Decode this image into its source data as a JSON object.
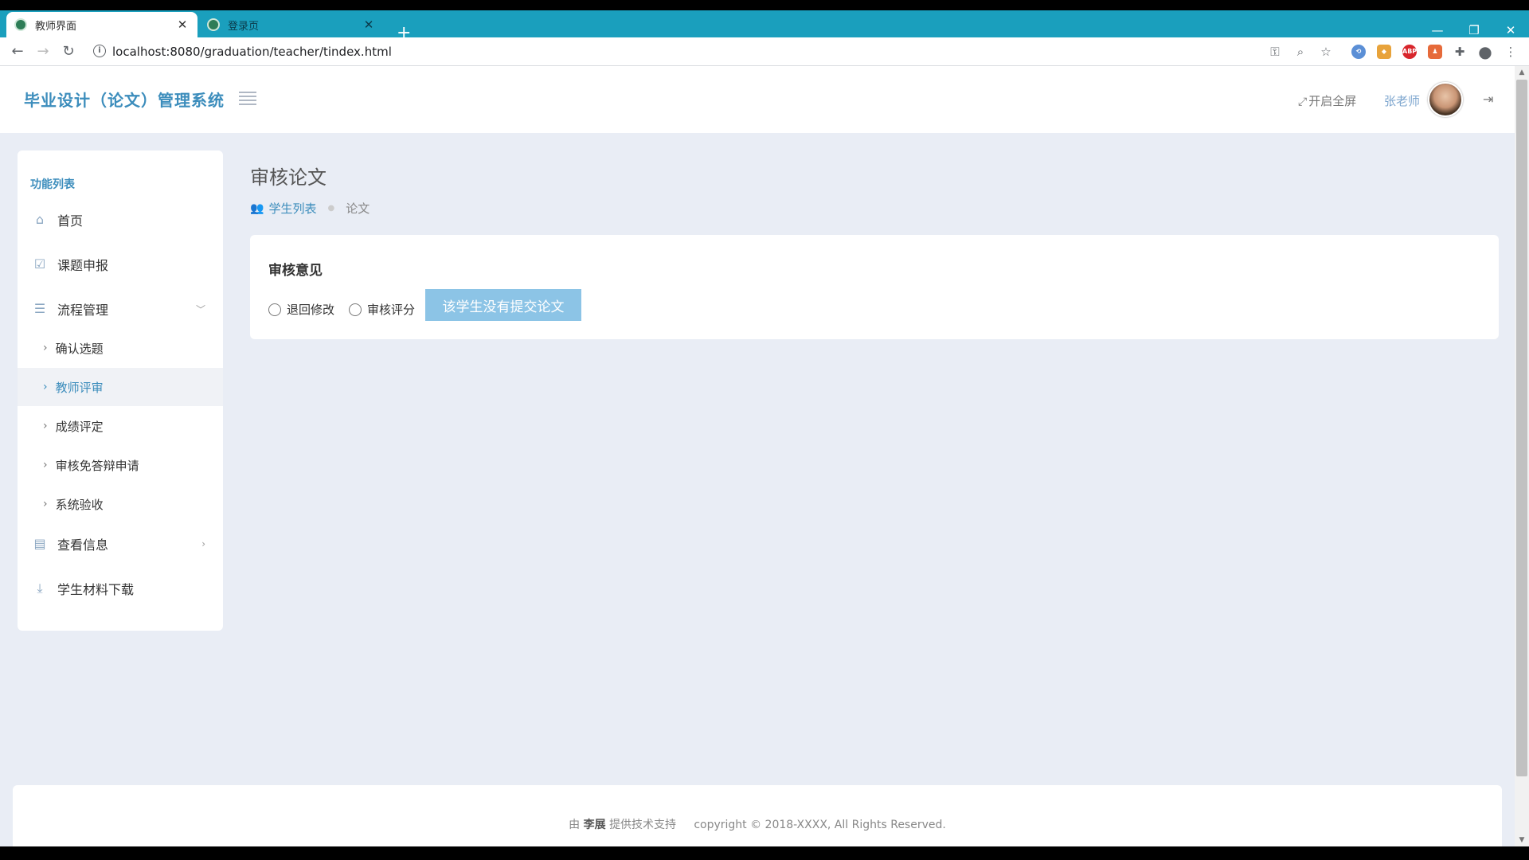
{
  "browser": {
    "tabs": [
      {
        "title": "教师界面",
        "active": true
      },
      {
        "title": "登录页",
        "active": false
      }
    ],
    "url": "localhost:8080/graduation/teacher/tindex.html"
  },
  "header": {
    "app_title": "毕业设计（论文）管理系统",
    "fullscreen_label": "开启全屏",
    "username": "张老师"
  },
  "sidebar": {
    "title": "功能列表",
    "items": [
      {
        "label": "首页",
        "icon": "home-icon"
      },
      {
        "label": "课题申报",
        "icon": "checkbox-icon"
      },
      {
        "label": "流程管理",
        "icon": "list-icon",
        "expanded": true
      },
      {
        "label": "查看信息",
        "icon": "document-icon"
      },
      {
        "label": "学生材料下载",
        "icon": "download-icon"
      }
    ],
    "sub_items": [
      {
        "label": "确认选题"
      },
      {
        "label": "教师评审",
        "active": true
      },
      {
        "label": "成绩评定"
      },
      {
        "label": "审核免答辩申请"
      },
      {
        "label": "系统验收"
      }
    ]
  },
  "content": {
    "page_title": "审核论文",
    "breadcrumb": {
      "link": "学生列表",
      "current": "论文"
    },
    "card": {
      "title": "审核意见",
      "options": [
        "退回修改",
        "审核评分"
      ],
      "button_label": "该学生没有提交论文"
    }
  },
  "footer": {
    "prefix": "由",
    "author": "李展",
    "suffix": "提供技术支持",
    "copyright": "copyright © 2018-XXXX, All Rights Reserved."
  },
  "colors": {
    "accent": "#3c8dbc",
    "tabstrip": "#1a9fbd",
    "page_bg": "#e9edf5",
    "disabled_button": "#8cc4e6"
  }
}
